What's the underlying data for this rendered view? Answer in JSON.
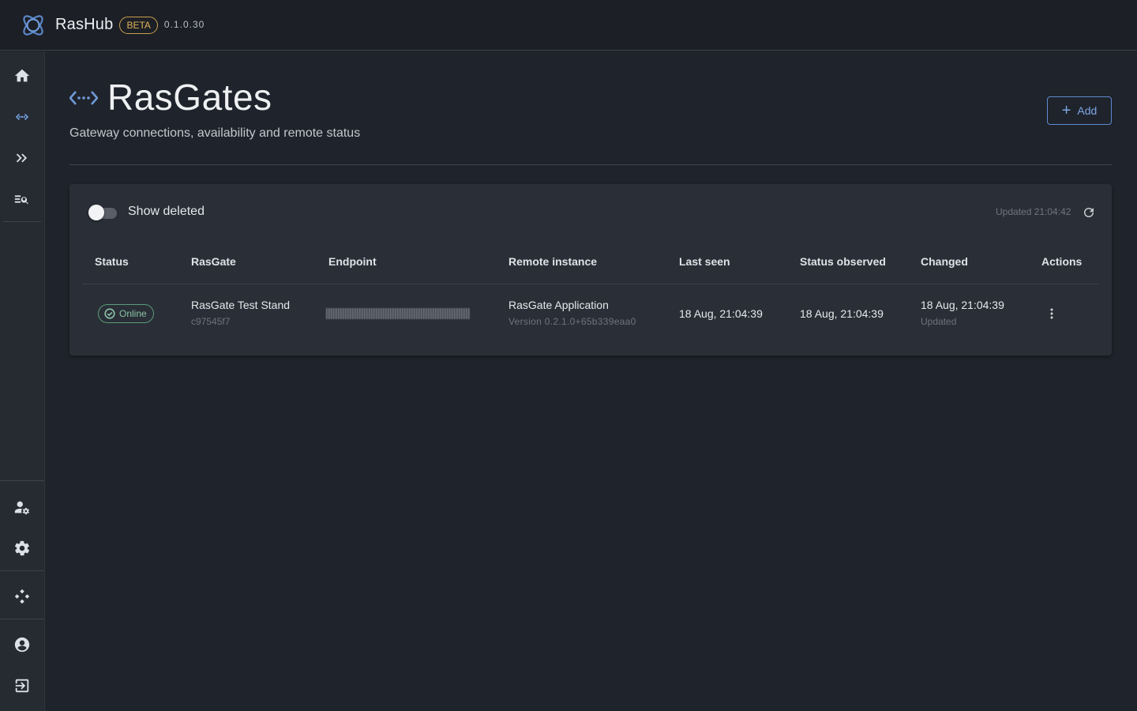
{
  "app": {
    "name": "RasHub",
    "badge": "BETA",
    "version": "0.1.0.30"
  },
  "sidebar": {
    "top_items": [
      {
        "icon": "home-icon"
      },
      {
        "icon": "gateway-icon"
      },
      {
        "icon": "double-chevron-icon"
      },
      {
        "icon": "search-list-icon"
      }
    ],
    "bottom_items": [
      {
        "icon": "user-settings-icon"
      },
      {
        "icon": "gear-icon"
      },
      {
        "icon": "network-icon"
      },
      {
        "icon": "account-circle-icon"
      },
      {
        "icon": "logout-icon"
      }
    ]
  },
  "page": {
    "title": "RasGates",
    "subtitle": "Gateway connections, availability and remote status",
    "add_label": "Add"
  },
  "toolbar": {
    "show_deleted_label": "Show deleted",
    "show_deleted_on": false,
    "updated_text": "Updated 21:04:42"
  },
  "table": {
    "headers": [
      "Status",
      "RasGate",
      "Endpoint",
      "Remote instance",
      "Last seen",
      "Status observed",
      "Changed",
      "Actions"
    ],
    "rows": [
      {
        "status": "Online",
        "rasgate_name": "RasGate Test Stand",
        "rasgate_id": "c97545f7",
        "remote_instance": "RasGate Application",
        "remote_version": "Version 0.2.1.0+65b339eaa0",
        "last_seen": "18 Aug, 21:04:39",
        "status_observed": "18 Aug, 21:04:39",
        "changed": "18 Aug, 21:04:39",
        "changed_sub": "Updated"
      }
    ]
  },
  "colors": {
    "background": "#1f232b",
    "card": "#2a2f37",
    "accent": "#7ea8e6",
    "online": "#8cc2a6",
    "beta": "#e1b45a"
  }
}
